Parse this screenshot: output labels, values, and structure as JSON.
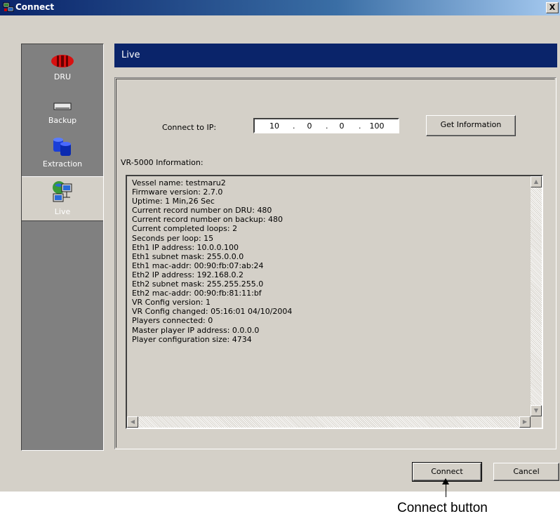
{
  "window": {
    "title": "Connect",
    "close_glyph": "X"
  },
  "sidebar": {
    "items": [
      {
        "label": "DRU",
        "icon": "dru-icon"
      },
      {
        "label": "Backup",
        "icon": "backup-drive-icon"
      },
      {
        "label": "Extraction",
        "icon": "database-icon"
      },
      {
        "label": "Live",
        "icon": "network-computer-icon",
        "active": true
      }
    ]
  },
  "header": {
    "title": "Live"
  },
  "connect": {
    "label": "Connect to IP:",
    "ip": [
      "10",
      "0",
      "0",
      "100"
    ],
    "get_info_label": "Get Information"
  },
  "info": {
    "label": "VR-5000 Information:",
    "lines": [
      "Vessel name: testmaru2",
      "Firmware version: 2.7.0",
      "Uptime: 1 Min,26 Sec",
      "Current record number on DRU: 480",
      "Current record number on backup: 480",
      "Current completed loops: 2",
      "Seconds per loop: 15",
      "Eth1 IP address: 10.0.0.100",
      "Eth1 subnet mask: 255.0.0.0",
      "Eth1 mac-addr: 00:90:fb:07:ab:24",
      "Eth2 IP address: 192.168.0.2",
      "Eth2 subnet mask: 255.255.255.0",
      "Eth2 mac-addr: 00:90:fb:81:11:bf",
      "VR Config version: 1",
      "VR Config changed: 05:16:01 04/10/2004",
      "Players connected: 0",
      "Master player IP address: 0.0.0.0",
      "Player configuration size: 4734"
    ]
  },
  "footer": {
    "connect_label": "Connect",
    "cancel_label": "Cancel"
  },
  "annotation": {
    "text": "Connect button"
  },
  "colors": {
    "title_bar": "#0a246a",
    "window_bg": "#d4d0c8",
    "sidebar_bg": "#808080",
    "header_bar": "#0a246a"
  }
}
